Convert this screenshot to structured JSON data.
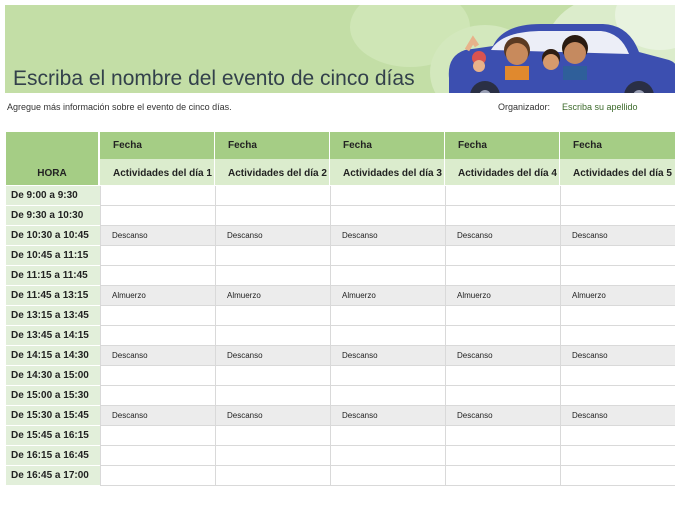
{
  "header": {
    "title": "Escriba el nombre del evento de cinco días",
    "subtitle": "Agregue más información sobre el evento de cinco días.",
    "organizer_label": "Organizador:",
    "organizer_value": "Escriba su apellido"
  },
  "colors": {
    "header_green": "#a5cd85",
    "light_green": "#dbeccd",
    "car_blue": "#3c4fb0",
    "shaded_row": "#ececec"
  },
  "schedule": {
    "time_header": "HORA",
    "days": [
      {
        "date": "Fecha",
        "activities": "Actividades del día 1"
      },
      {
        "date": "Fecha",
        "activities": "Actividades del día 2"
      },
      {
        "date": "Fecha",
        "activities": "Actividades del día 3"
      },
      {
        "date": "Fecha",
        "activities": "Actividades del día 4"
      },
      {
        "date": "Fecha",
        "activities": "Actividades del día 5"
      }
    ],
    "rows": [
      {
        "time": "De 9:00 a 9:30",
        "cells": [
          "",
          "",
          "",
          "",
          ""
        ]
      },
      {
        "time": "De 9:30 a 10:30",
        "cells": [
          "",
          "",
          "",
          "",
          ""
        ]
      },
      {
        "time": "De 10:30 a 10:45",
        "cells": [
          "Descanso",
          "Descanso",
          "Descanso",
          "Descanso",
          "Descanso"
        ]
      },
      {
        "time": "De 10:45 a 11:15",
        "cells": [
          "",
          "",
          "",
          "",
          ""
        ]
      },
      {
        "time": "De 11:15 a 11:45",
        "cells": [
          "",
          "",
          "",
          "",
          ""
        ]
      },
      {
        "time": "De 11:45 a 13:15",
        "cells": [
          "Almuerzo",
          "Almuerzo",
          "Almuerzo",
          "Almuerzo",
          "Almuerzo"
        ]
      },
      {
        "time": "De 13:15 a 13:45",
        "cells": [
          "",
          "",
          "",
          "",
          ""
        ]
      },
      {
        "time": "De 13:45 a 14:15",
        "cells": [
          "",
          "",
          "",
          "",
          ""
        ]
      },
      {
        "time": "De 14:15 a 14:30",
        "cells": [
          "Descanso",
          "Descanso",
          "Descanso",
          "Descanso",
          "Descanso"
        ]
      },
      {
        "time": "De 14:30 a 15:00",
        "cells": [
          "",
          "",
          "",
          "",
          ""
        ]
      },
      {
        "time": "De 15:00 a 15:30",
        "cells": [
          "",
          "",
          "",
          "",
          ""
        ]
      },
      {
        "time": "De 15:30 a 15:45",
        "cells": [
          "Descanso",
          "Descanso",
          "Descanso",
          "Descanso",
          "Descanso"
        ]
      },
      {
        "time": "De 15:45 a 16:15",
        "cells": [
          "",
          "",
          "",
          "",
          ""
        ]
      },
      {
        "time": "De 16:15 a 16:45",
        "cells": [
          "",
          "",
          "",
          "",
          ""
        ]
      },
      {
        "time": "De 16:45 a 17:00",
        "cells": [
          "",
          "",
          "",
          "",
          ""
        ]
      }
    ]
  }
}
